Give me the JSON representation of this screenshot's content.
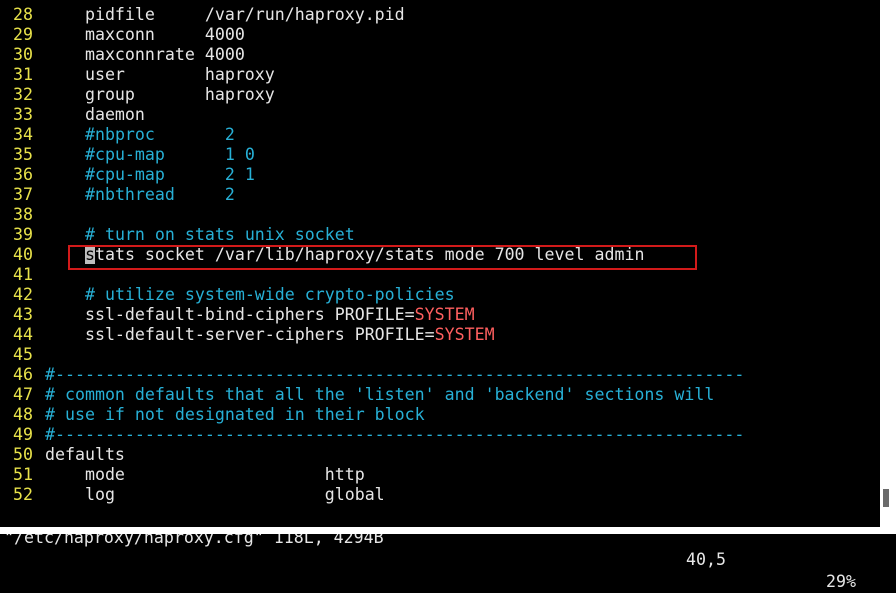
{
  "editor": {
    "lines": [
      {
        "n": "28",
        "parts": [
          {
            "t": "    pidfile     /var/run/haproxy.pid",
            "c": ""
          }
        ]
      },
      {
        "n": "29",
        "parts": [
          {
            "t": "    maxconn     4000",
            "c": ""
          }
        ]
      },
      {
        "n": "30",
        "parts": [
          {
            "t": "    maxconnrate 4000",
            "c": ""
          }
        ]
      },
      {
        "n": "31",
        "parts": [
          {
            "t": "    user        haproxy",
            "c": ""
          }
        ]
      },
      {
        "n": "32",
        "parts": [
          {
            "t": "    group       haproxy",
            "c": ""
          }
        ]
      },
      {
        "n": "33",
        "parts": [
          {
            "t": "    daemon",
            "c": ""
          }
        ]
      },
      {
        "n": "34",
        "parts": [
          {
            "t": "    ",
            "c": ""
          },
          {
            "t": "#nbproc       2",
            "c": "cmt"
          }
        ]
      },
      {
        "n": "35",
        "parts": [
          {
            "t": "    ",
            "c": ""
          },
          {
            "t": "#cpu-map      1 0",
            "c": "cmt"
          }
        ]
      },
      {
        "n": "36",
        "parts": [
          {
            "t": "    ",
            "c": ""
          },
          {
            "t": "#cpu-map      2 1",
            "c": "cmt"
          }
        ]
      },
      {
        "n": "37",
        "parts": [
          {
            "t": "    ",
            "c": ""
          },
          {
            "t": "#nbthread     2",
            "c": "cmt"
          }
        ]
      },
      {
        "n": "38",
        "parts": []
      },
      {
        "n": "39",
        "parts": [
          {
            "t": "    ",
            "c": ""
          },
          {
            "t": "# turn on stats unix socket",
            "c": "cmt"
          }
        ]
      },
      {
        "n": "40",
        "parts": [
          {
            "t": "    ",
            "c": ""
          },
          {
            "t": "s",
            "c": "cur"
          },
          {
            "t": "tats socket /var/lib/haproxy/stats mode 700 level admin",
            "c": ""
          }
        ]
      },
      {
        "n": "41",
        "parts": []
      },
      {
        "n": "42",
        "parts": [
          {
            "t": "    ",
            "c": ""
          },
          {
            "t": "# utilize system-wide crypto-policies",
            "c": "cmt"
          }
        ]
      },
      {
        "n": "43",
        "parts": [
          {
            "t": "    ssl-default-bind-ciphers PROFILE=",
            "c": ""
          },
          {
            "t": "SYSTEM",
            "c": "kw"
          }
        ]
      },
      {
        "n": "44",
        "parts": [
          {
            "t": "    ssl-default-server-ciphers PROFILE=",
            "c": ""
          },
          {
            "t": "SYSTEM",
            "c": "kw"
          }
        ]
      },
      {
        "n": "45",
        "parts": []
      },
      {
        "n": "46",
        "parts": [
          {
            "t": "#---------------------------------------------------------------------",
            "c": "cmt"
          }
        ]
      },
      {
        "n": "47",
        "parts": [
          {
            "t": "# common defaults that all the 'listen' and 'backend' sections will",
            "c": "cmt"
          }
        ]
      },
      {
        "n": "48",
        "parts": [
          {
            "t": "# use if not designated in their block",
            "c": "cmt"
          }
        ]
      },
      {
        "n": "49",
        "parts": [
          {
            "t": "#---------------------------------------------------------------------",
            "c": "cmt"
          }
        ]
      },
      {
        "n": "50",
        "parts": [
          {
            "t": "defaults",
            "c": ""
          }
        ]
      },
      {
        "n": "51",
        "parts": [
          {
            "t": "    mode                    http",
            "c": ""
          }
        ]
      },
      {
        "n": "52",
        "parts": [
          {
            "t": "    log                     global",
            "c": ""
          }
        ]
      }
    ]
  },
  "status": {
    "file": "\"/etc/haproxy/haproxy.cfg\" 118L, 4294B",
    "position": "40,5",
    "percent": "29%"
  }
}
